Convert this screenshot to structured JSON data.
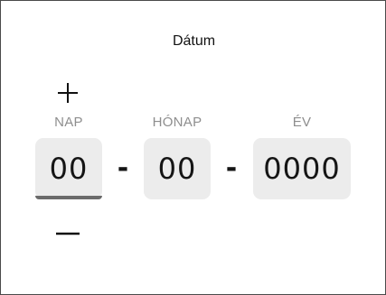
{
  "dialog": {
    "title": "Dátum"
  },
  "date_picker": {
    "day": {
      "label": "NAP",
      "value": "00"
    },
    "month": {
      "label": "HÓNAP",
      "value": "00"
    },
    "year": {
      "label": "ÉV",
      "value": "0000"
    },
    "separator": "-",
    "increment_icon": "plus-icon",
    "decrement_icon": "minus-icon",
    "active_field": "day"
  },
  "colors": {
    "field_background": "#ececec",
    "label_text": "#8e8e8e",
    "active_underline": "#6b6b6b",
    "border": "#4a4a4a"
  }
}
